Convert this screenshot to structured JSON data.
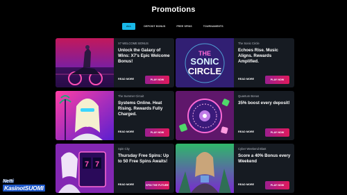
{
  "page": {
    "title": "Promotions"
  },
  "tabs": [
    {
      "label": "ALL",
      "active": true
    },
    {
      "label": "DEPOSIT BONUS",
      "active": false
    },
    {
      "label": "FREE SPINS",
      "active": false
    },
    {
      "label": "TOURNAMENTS",
      "active": false
    }
  ],
  "cards": [
    {
      "category": "X7 WELCOME BONUS",
      "headline": "Unlock the Galaxy of Wins: X7's Epic Welcome Bonus!",
      "read_more": "READ MORE",
      "cta": "PLAY NOW",
      "image": "neon-motorcycle-rider"
    },
    {
      "category": "The Sonic Circle",
      "headline": "Echoes Rise. Music Aligns. Rewards Amplified.",
      "read_more": "READ MORE",
      "cta": "PLAY NOW",
      "image": "the-sonic-circle-logo",
      "image_text": [
        "THE",
        "SONIC",
        "CIRCLE"
      ]
    },
    {
      "category": "The Summer Circuit",
      "headline": "Systems Online. Heat Rising. Rewards Fully Charged.",
      "read_more": "READ MORE",
      "cta": "PLAY NOW",
      "image": "cyber-woman-palms"
    },
    {
      "category": "Quantum Bonus",
      "headline": "35% boost every deposit!",
      "read_more": "READ MORE",
      "cta": "PLAY NOW",
      "image": "quantum-roulette-wheel"
    },
    {
      "category": "Spin City",
      "headline": "Thursday Free Spins: Up to 50 Free Spins Awaits!",
      "read_more": "READ MORE",
      "cta": "SPIN THE FUTURE",
      "image": "slot-machine-woman",
      "image_text": [
        "7",
        "7"
      ]
    },
    {
      "category": "Cyber Weekend Blast",
      "headline": "Score a 40% Bonus every Weekend",
      "read_more": "READ MORE",
      "cta": "PLAY NOW",
      "image": "cyber-warrior-woman"
    }
  ],
  "logo": {
    "line1": "Netti",
    "line2": "KasinotSUOMI"
  },
  "colors": {
    "background": "#000000",
    "card": "#161b22",
    "tab_active": "#19b8e8",
    "cta_start": "#9b1e8f",
    "cta_end": "#e01a5c"
  }
}
